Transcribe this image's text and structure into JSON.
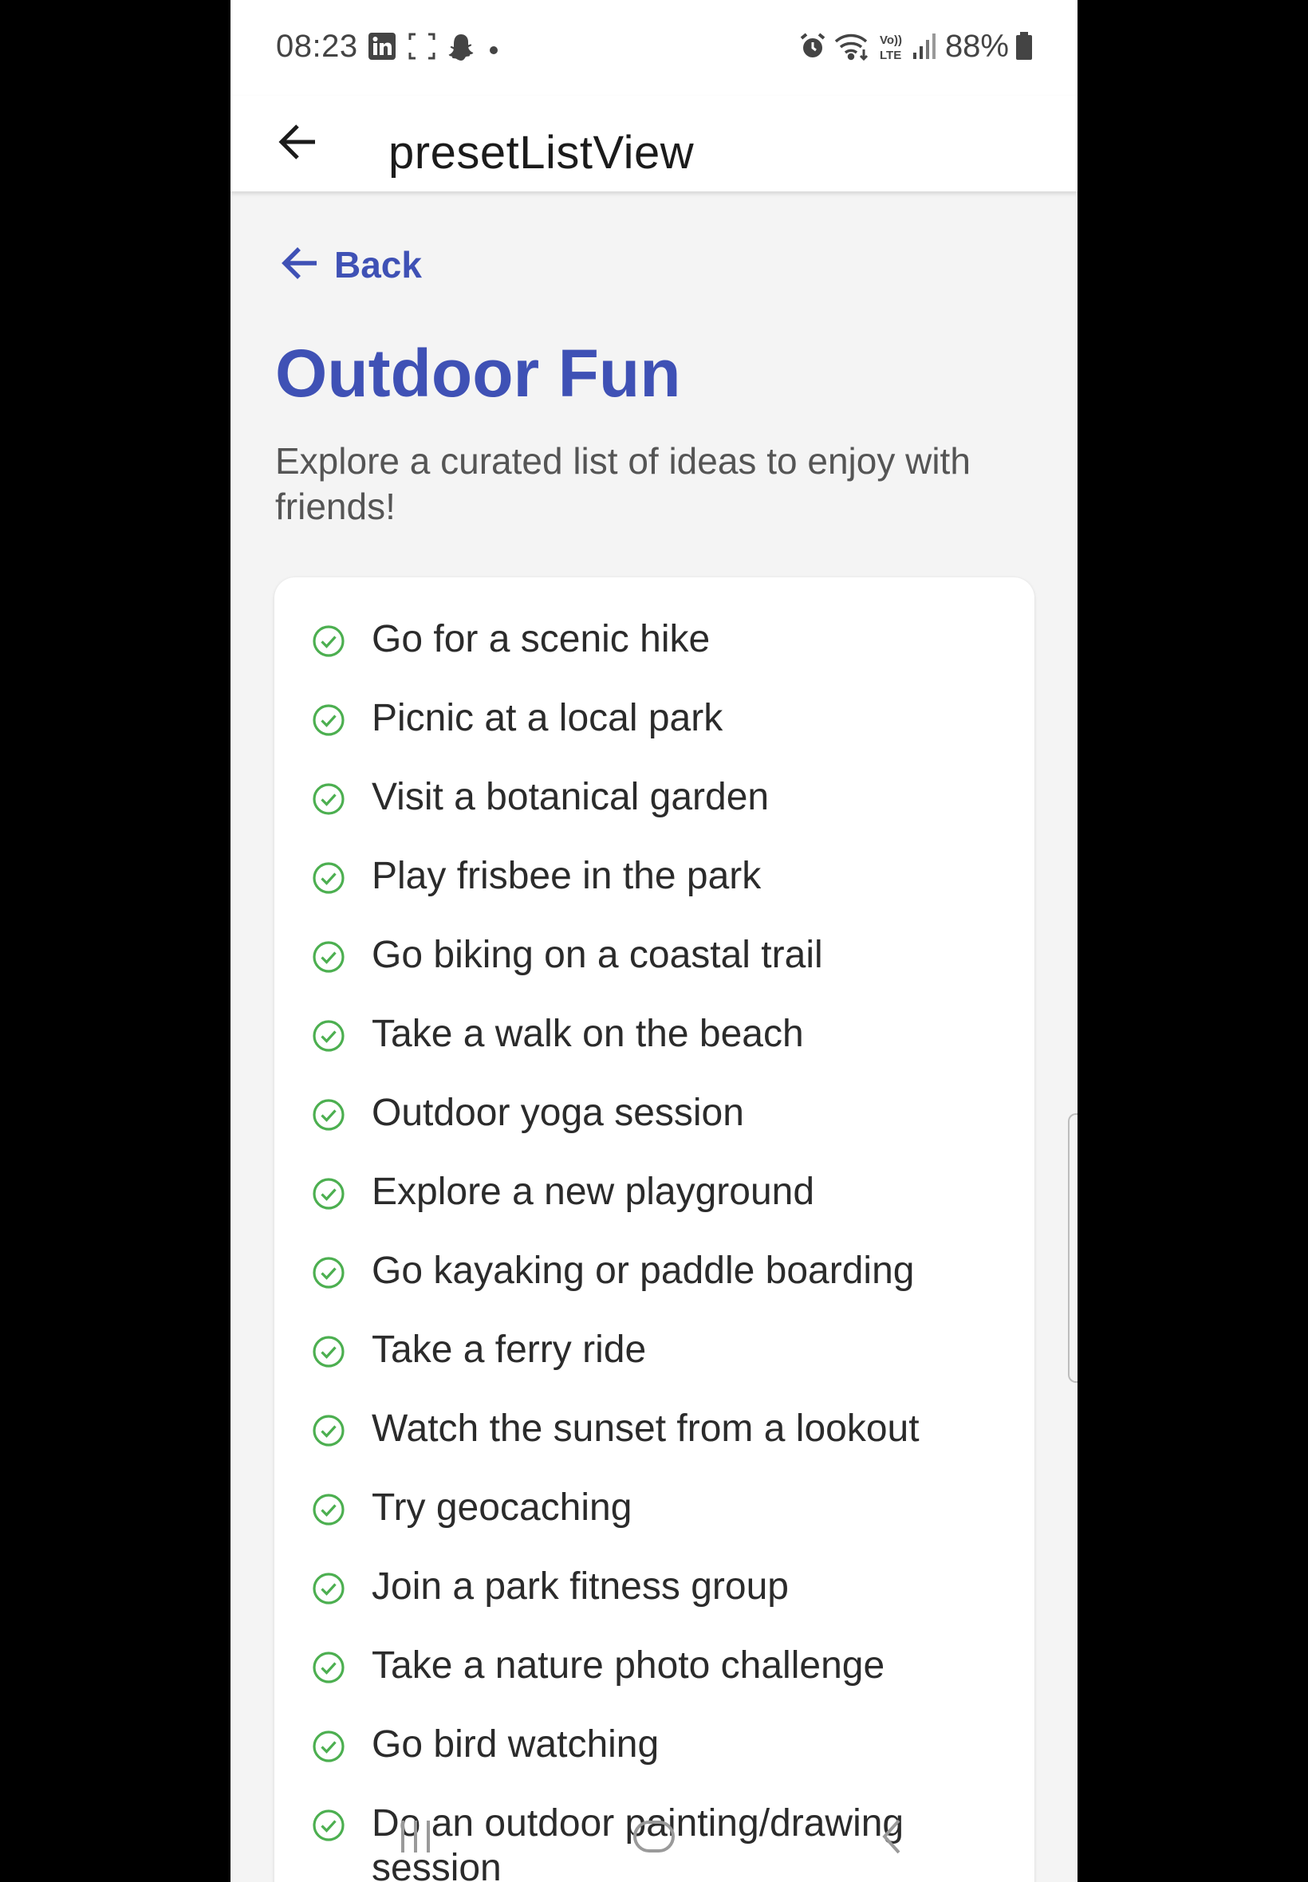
{
  "status_bar": {
    "time": "08:23",
    "battery": "88%",
    "icons": [
      "linkedin-icon",
      "screenshot-icon",
      "snapchat-icon",
      "dot-icon",
      "alarm-icon",
      "wifi-icon",
      "volte-icon",
      "signal-icon",
      "battery-icon"
    ]
  },
  "app_bar": {
    "title": "presetListView",
    "back_icon": "arrow-left-icon"
  },
  "content": {
    "back_label": "Back",
    "title": "Outdoor Fun",
    "subtitle": "Explore a curated list of ideas to enjoy with friends!",
    "items": [
      "Go for a scenic hike",
      "Picnic at a local park",
      "Visit a botanical garden",
      "Play frisbee in the park",
      "Go biking on a coastal trail",
      "Take a walk on the beach",
      "Outdoor yoga session",
      "Explore a new playground",
      "Go kayaking or paddle boarding",
      "Take a ferry ride",
      "Watch the sunset from a lookout",
      "Try geocaching",
      "Join a park fitness group",
      "Take a nature photo challenge",
      "Go bird watching",
      "Do an outdoor painting/drawing session"
    ]
  },
  "colors": {
    "accent": "#3f51b5",
    "check": "#4caf50",
    "background": "#f4f4f4"
  },
  "nav_bar": {
    "icons": [
      "recents-icon",
      "home-icon",
      "back-icon"
    ]
  }
}
